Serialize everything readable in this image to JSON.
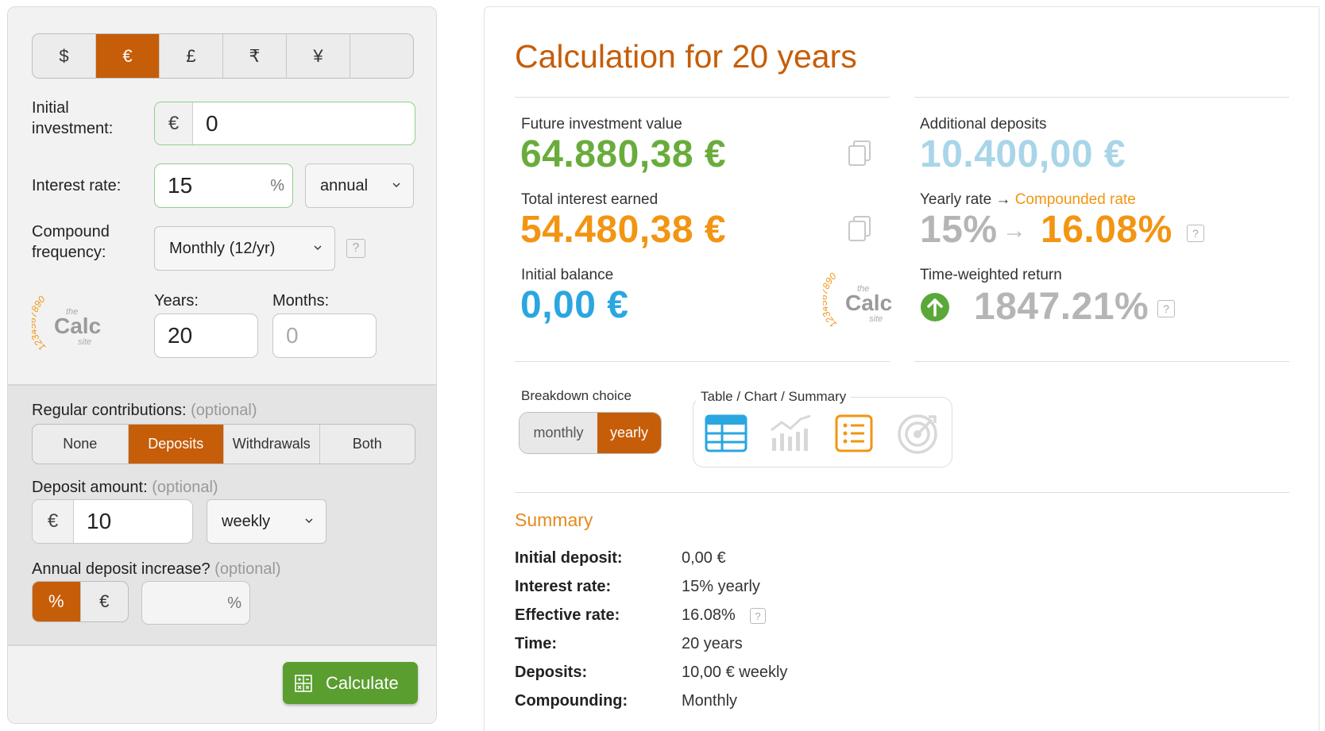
{
  "currencies": {
    "options": [
      "$",
      "€",
      "£",
      "₹",
      "¥",
      ""
    ],
    "selected": "€"
  },
  "form": {
    "initial_label": "Initial\ninvestment:",
    "initial_prefix": "€",
    "initial_value": "0",
    "rate_label": "Interest rate:",
    "rate_value": "15",
    "rate_suffix": "%",
    "rate_period": "annual",
    "compound_label": "Compound\nfrequency:",
    "compound_value": "Monthly (12/yr)",
    "help": "?",
    "years_label": "Years:",
    "years_value": "20",
    "months_label": "Months:",
    "months_placeholder": "0"
  },
  "contributions": {
    "label": "Regular contributions:",
    "optional": "(optional)",
    "options": [
      "None",
      "Deposits",
      "Withdrawals",
      "Both"
    ],
    "selected": "Deposits",
    "amount_label": "Deposit amount:",
    "amount_prefix": "€",
    "amount_value": "10",
    "amount_period": "weekly",
    "increase_label": "Annual deposit increase?",
    "increase_options": [
      "%",
      "€"
    ],
    "increase_selected": "%",
    "increase_suffix": "%"
  },
  "calculate_label": "Calculate",
  "logo": {
    "digits": "1234567890",
    "the": "the",
    "calc": "Calc",
    "site": "site"
  },
  "results": {
    "title": "Calculation for 20 years",
    "future_label": "Future investment value",
    "future_value": "64.880,38 €",
    "interest_label": "Total interest earned",
    "interest_value": "54.480,38 €",
    "initial_label": "Initial balance",
    "initial_value": "0,00 €",
    "deposits_label": "Additional deposits",
    "deposits_value": "10.400,00 €",
    "yearly_label": "Yearly rate →",
    "compounded_label": "Compounded rate",
    "yearly_value": "15%",
    "arrow": "→",
    "compounded_value": "16.08%",
    "twr_label": "Time-weighted return",
    "twr_value": "1847.21%"
  },
  "breakdown": {
    "label": "Breakdown choice",
    "options": [
      "monthly",
      "yearly"
    ],
    "selected": "yearly",
    "view_label": "Table / Chart / Summary"
  },
  "summary": {
    "title": "Summary",
    "rows": [
      {
        "label": "Initial deposit:",
        "value": "0,00 €"
      },
      {
        "label": "Interest rate:",
        "value": "15% yearly"
      },
      {
        "label": "Effective rate:",
        "value": "16.08%"
      },
      {
        "label": "Time:",
        "value": "20 years"
      },
      {
        "label": "Deposits:",
        "value": "10,00 € weekly"
      },
      {
        "label": "Compounding:",
        "value": "Monthly"
      }
    ]
  },
  "colors": {
    "accent": "#c65d08",
    "green": "#6aac3c",
    "orange": "#f29512",
    "blue": "#2aa6e0",
    "lightblue": "#a9d5e8",
    "calculate_button": "#5a9e2f"
  }
}
